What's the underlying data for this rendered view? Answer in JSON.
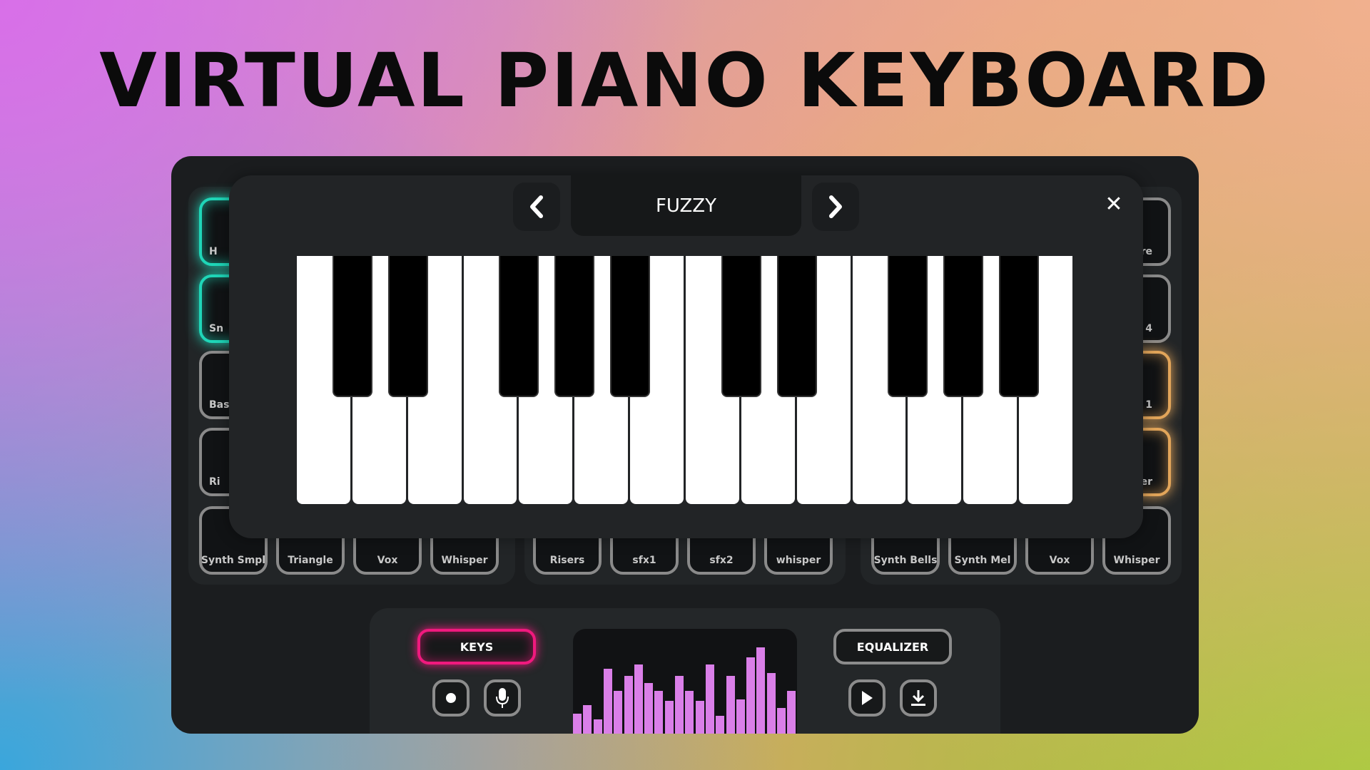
{
  "title": "VIRTUAL PIANO KEYBOARD",
  "colors": {
    "teal": "#1fd6b8",
    "orange": "#e2a55a",
    "pink": "#f0197e",
    "bars": "#da7fe8"
  },
  "pads": {
    "left": {
      "col0": [
        "H",
        "Sn",
        "Bas",
        "Ri"
      ],
      "bottom": [
        "Synth Smpl",
        "Triangle",
        "Vox",
        "Whisper"
      ]
    },
    "middle": {
      "bottom": [
        "Risers",
        "sfx1",
        "sfx2",
        "whisper"
      ]
    },
    "right": {
      "col3": [
        "re",
        "4",
        "1",
        "er"
      ],
      "bottom": [
        "Synth Bells",
        "Synth Mel",
        "Vox",
        "Whisper"
      ]
    }
  },
  "modal": {
    "preset": "FUZZY",
    "prev_icon": "chevron-left-icon",
    "next_icon": "chevron-right-icon",
    "close": "✕",
    "white_keys": 14,
    "black_keys": 10
  },
  "controls": {
    "keys_label": "KEYS",
    "equalizer_label": "EQUALIZER",
    "active_mode": "KEYS"
  },
  "visualizer": {
    "levels": [
      50,
      72,
      36,
      162,
      107,
      144,
      173,
      126,
      107,
      83,
      144,
      107,
      83,
      173,
      44,
      144,
      86,
      191,
      216,
      151,
      65,
      107
    ]
  }
}
